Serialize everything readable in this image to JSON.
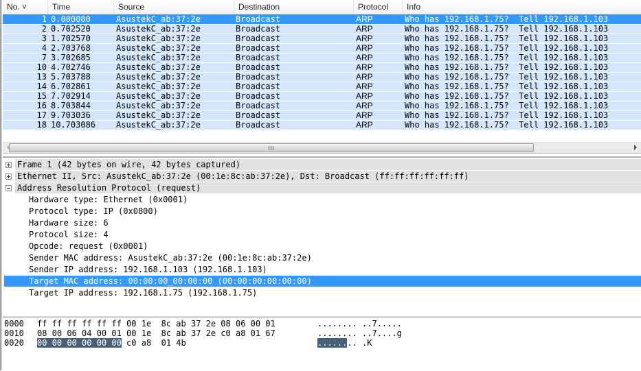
{
  "packet_list": {
    "columns": [
      "No. ˅",
      "Time",
      "Source",
      "Destination",
      "Protocol",
      "Info"
    ],
    "rows": [
      {
        "no": "1",
        "time": "0.000000",
        "source": "AsustekC_ab:37:2e",
        "destination": "Broadcast",
        "protocol": "ARP",
        "info": "Who has 192.168.1.75?  Tell 192.168.1.103",
        "selected": true
      },
      {
        "no": "2",
        "time": "0.702520",
        "source": "AsustekC_ab:37:2e",
        "destination": "Broadcast",
        "protocol": "ARP",
        "info": "Who has 192.168.1.75?  Tell 192.168.1.103"
      },
      {
        "no": "3",
        "time": "1.702570",
        "source": "AsustekC_ab:37:2e",
        "destination": "Broadcast",
        "protocol": "ARP",
        "info": "Who has 192.168.1.75?  Tell 192.168.1.103"
      },
      {
        "no": "4",
        "time": "2.703768",
        "source": "AsustekC_ab:37:2e",
        "destination": "Broadcast",
        "protocol": "ARP",
        "info": "Who has 192.168.1.75?  Tell 192.168.1.103"
      },
      {
        "no": "7",
        "time": "3.702685",
        "source": "AsustekC_ab:37:2e",
        "destination": "Broadcast",
        "protocol": "ARP",
        "info": "Who has 192.168.1.75?  Tell 192.168.1.103"
      },
      {
        "no": "10",
        "time": "4.702746",
        "source": "AsustekC_ab:37:2e",
        "destination": "Broadcast",
        "protocol": "ARP",
        "info": "Who has 192.168.1.75?  Tell 192.168.1.103"
      },
      {
        "no": "13",
        "time": "5.703788",
        "source": "AsustekC_ab:37:2e",
        "destination": "Broadcast",
        "protocol": "ARP",
        "info": "Who has 192.168.1.75?  Tell 192.168.1.103"
      },
      {
        "no": "14",
        "time": "6.702861",
        "source": "AsustekC_ab:37:2e",
        "destination": "Broadcast",
        "protocol": "ARP",
        "info": "Who has 192.168.1.75?  Tell 192.168.1.103"
      },
      {
        "no": "15",
        "time": "7.702914",
        "source": "AsustekC_ab:37:2e",
        "destination": "Broadcast",
        "protocol": "ARP",
        "info": "Who has 192.168.1.75?  Tell 192.168.1.103"
      },
      {
        "no": "16",
        "time": "8.703844",
        "source": "AsustekC_ab:37:2e",
        "destination": "Broadcast",
        "protocol": "ARP",
        "info": "Who has 192.168.1.75?  Tell 192.168.1.103"
      },
      {
        "no": "17",
        "time": "9.703036",
        "source": "AsustekC_ab:37:2e",
        "destination": "Broadcast",
        "protocol": "ARP",
        "info": "Who has 192.168.1.75?  Tell 192.168.1.103"
      },
      {
        "no": "18",
        "time": "10.703086",
        "source": "AsustekC_ab:37:2e",
        "destination": "Broadcast",
        "protocol": "ARP",
        "info": "Who has 192.168.1.75?  Tell 192.168.1.103"
      }
    ]
  },
  "scrollbar": {
    "grip_icon": "grip-icon"
  },
  "details": {
    "top_items": [
      {
        "label": "Frame 1 (42 bytes on wire, 42 bytes captured)",
        "expanded": false
      },
      {
        "label": "Ethernet II, Src: AsustekC_ab:37:2e (00:1e:8c:ab:37:2e), Dst: Broadcast (ff:ff:ff:ff:ff:ff)",
        "expanded": false
      },
      {
        "label": "Address Resolution Protocol (request)",
        "expanded": true
      }
    ],
    "arp_fields": [
      {
        "label": "Hardware type: Ethernet (0x0001)"
      },
      {
        "label": "Protocol type: IP (0x0800)"
      },
      {
        "label": "Hardware size: 6"
      },
      {
        "label": "Protocol size: 4"
      },
      {
        "label": "Opcode: request (0x0001)"
      },
      {
        "label": "Sender MAC address: AsustekC_ab:37:2e (00:1e:8c:ab:37:2e)"
      },
      {
        "label": "Sender IP address: 192.168.1.103 (192.168.1.103)"
      },
      {
        "label": "Target MAC address: 00:00:00_00:00:00 (00:00:00:00:00:00)",
        "selected": true
      },
      {
        "label": "Target IP address: 192.168.1.75 (192.168.1.75)"
      }
    ]
  },
  "bytes": {
    "rows": [
      {
        "offset": "0000",
        "hex_pre": "",
        "hex_hl": "",
        "hex_post": "ff ff ff ff ff ff 00 1e  8c ab 37 2e 08 06 00 01",
        "ascii_pre": "",
        "ascii_hl": "",
        "ascii_post": "........ ..7....."
      },
      {
        "offset": "0010",
        "hex_pre": "",
        "hex_hl": "",
        "hex_post": "08 00 06 04 00 01 00 1e  8c ab 37 2e c0 a8 01 67",
        "ascii_pre": "",
        "ascii_hl": "",
        "ascii_post": "........ ..7....g"
      },
      {
        "offset": "0020",
        "hex_pre": "",
        "hex_hl": "00 00 00 00 00 00",
        "hex_post": " c0 a8  01 4b",
        "ascii_pre": "",
        "ascii_hl": "......",
        "ascii_post": ".. .K"
      }
    ]
  },
  "colors": {
    "selection": "#3399ff",
    "row_arp": "#d5e6fb",
    "tree_header": "#e1e1e1",
    "bytes_highlight": "#4a6079"
  }
}
